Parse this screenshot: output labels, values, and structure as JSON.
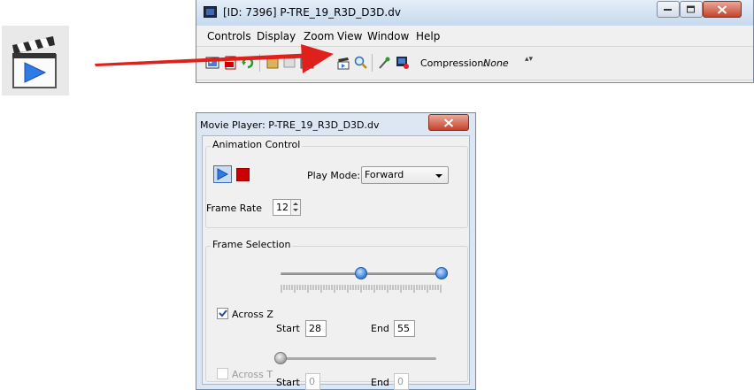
{
  "main_window": {
    "title": "[ID: 7396] P-TRE_19_R3D_D3D.dv",
    "menu": [
      "Controls",
      "Display",
      "Zoom",
      "View",
      "Window",
      "Help"
    ],
    "toolbar": {
      "compression_label": "Compression:",
      "compression_value": "None",
      "spinner_glyph": "▴▾",
      "icons": [
        "screenshot-icon",
        "pdf-icon",
        "refresh-icon",
        "save-icon",
        "clear-icon",
        "movie-player-icon",
        "zoom-icon",
        "pick-icon",
        "export-icon"
      ]
    }
  },
  "movie_player": {
    "title": "Movie Player: P-TRE_19_R3D_D3D.dv",
    "animation": {
      "legend": "Animation Control",
      "play_mode_label": "Play Mode:",
      "play_mode_value": "Forward",
      "frame_rate_label": "Frame Rate",
      "frame_rate_value": "12"
    },
    "selection": {
      "legend": "Frame Selection",
      "z": {
        "label": "Across Z",
        "checked": true,
        "start_label": "Start",
        "start": "28",
        "end_label": "End",
        "end": "55",
        "slider_start_fraction": 0.5,
        "slider_end_fraction": 1.0
      },
      "t": {
        "label": "Across T",
        "checked": false,
        "enabled": false,
        "start_label": "Start",
        "start": "0",
        "end_label": "End",
        "end": "0",
        "slider_fraction": 0.0
      }
    }
  },
  "annotation": {
    "arrow_color": "#e0201a",
    "target": "movie-player-icon"
  },
  "colors": {
    "stop": "#cc0000",
    "play": "#2f7ae5",
    "knob": "#3a7bd5"
  }
}
